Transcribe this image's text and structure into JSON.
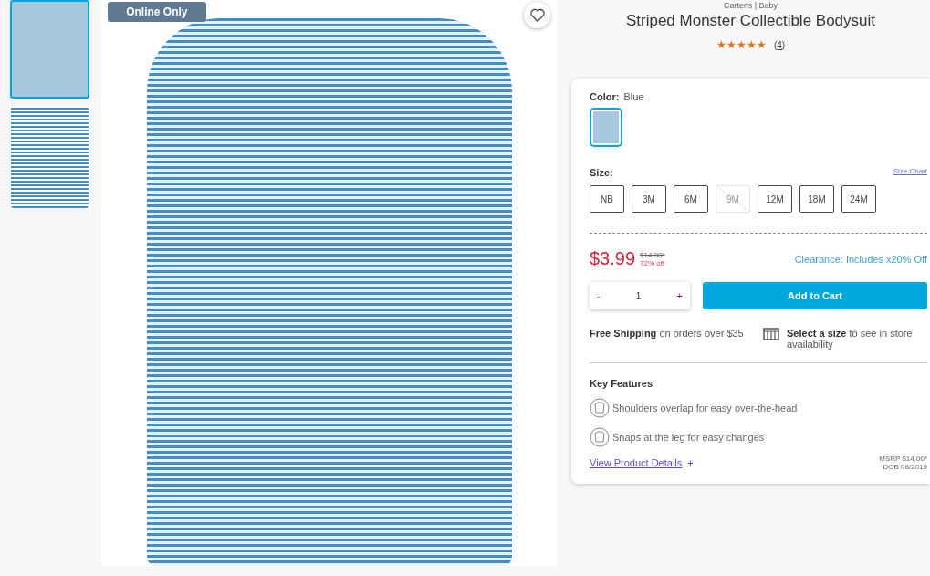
{
  "thumbnails": [
    {
      "selected": true
    },
    {
      "selected": false
    }
  ],
  "badge": "Online Only",
  "product": {
    "brand": "Carter's | Baby",
    "title": "Striped Monster Collectible Bodysuit",
    "stars": 5,
    "review_count": "(4)"
  },
  "color": {
    "label": "Color:",
    "value": "Blue",
    "swatches": [
      {
        "selected": true
      }
    ]
  },
  "size": {
    "label": "Size:",
    "chart_link": "Size Chart",
    "options": [
      {
        "label": "NB",
        "disabled": false
      },
      {
        "label": "3M",
        "disabled": false
      },
      {
        "label": "6M",
        "disabled": false
      },
      {
        "label": "9M",
        "disabled": true
      },
      {
        "label": "12M",
        "disabled": false
      },
      {
        "label": "18M",
        "disabled": false
      },
      {
        "label": "24M",
        "disabled": false
      }
    ]
  },
  "price": {
    "sale": "$3.99",
    "original": "$14.00*",
    "discount": "72% off",
    "promo": "Clearance: Includes x20% Off"
  },
  "quantity": {
    "minus": "-",
    "value": "1",
    "plus": "+"
  },
  "add_to_cart": "Add to Cart",
  "shipping": "**Free Shipping** on orders over $35",
  "store": "**Select a size** to see in store availability",
  "key_features": {
    "title": "Key Features",
    "items": [
      "Shoulders overlap for easy over-the-head",
      "Snaps at the leg for easy changes"
    ]
  },
  "details_link": "View Product Details",
  "details_plus": "+",
  "msrp": "MSRP $14.00*",
  "dob": "DOB 08/2019"
}
